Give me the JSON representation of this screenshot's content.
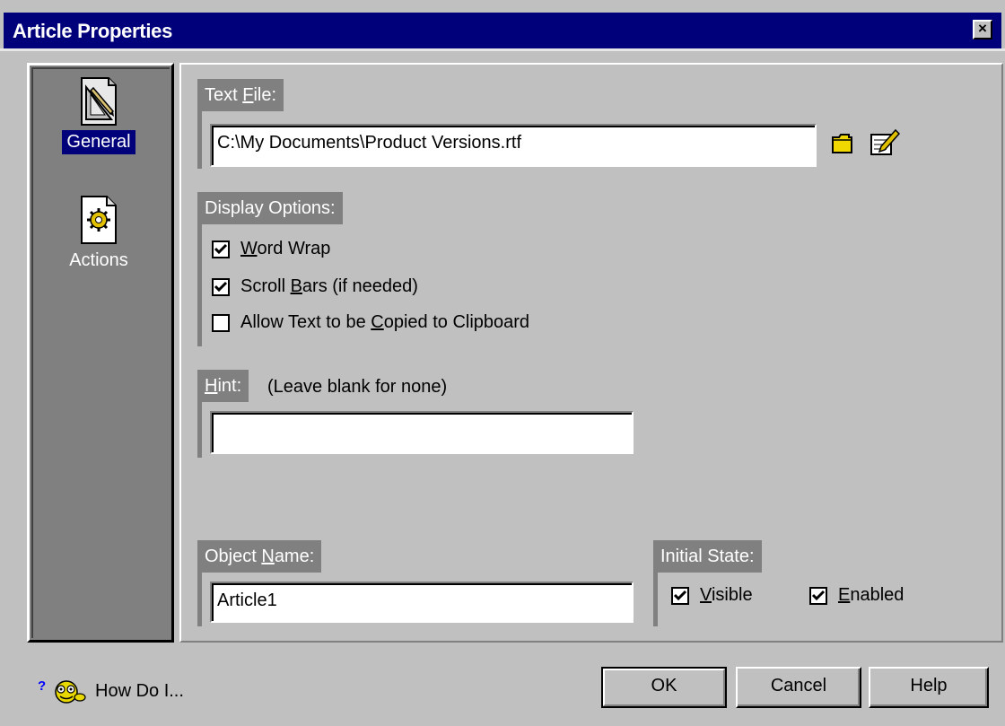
{
  "window": {
    "title": "Article Properties",
    "close_glyph": "×"
  },
  "sidebar": {
    "items": [
      {
        "label": "General",
        "icon": "pencil-ruler-icon",
        "selected": true
      },
      {
        "label": "Actions",
        "icon": "gear-page-icon",
        "selected": false
      }
    ]
  },
  "text_file": {
    "label_pre": "Text ",
    "label_mnemonic": "F",
    "label_post": "ile:",
    "value": "C:\\My Documents\\Product Versions.rtf",
    "browse_icon": "folder-icon",
    "edit_icon": "edit-document-icon"
  },
  "display_options": {
    "label": "Display Options:",
    "options": [
      {
        "pre": "",
        "mnemonic": "W",
        "post": "ord Wrap",
        "checked": true
      },
      {
        "pre": "Scroll ",
        "mnemonic": "B",
        "post": "ars (if needed)",
        "checked": true
      },
      {
        "pre": "Allow Text to be ",
        "mnemonic": "C",
        "post": "opied to Clipboard",
        "checked": false
      }
    ]
  },
  "hint": {
    "label_mnemonic": "H",
    "label_post": "int:",
    "note": "(Leave blank for none)",
    "value": ""
  },
  "object_name": {
    "label_pre": "Object ",
    "label_mnemonic": "N",
    "label_post": "ame:",
    "value": "Article1"
  },
  "initial_state": {
    "label": "Initial State:",
    "visible": {
      "mnemonic": "V",
      "post": "isible",
      "checked": true
    },
    "enabled": {
      "mnemonic": "E",
      "post": "nabled",
      "checked": true
    }
  },
  "footer": {
    "how_do_i": "How Do I...",
    "ok": "OK",
    "cancel": "Cancel",
    "help": "Help"
  },
  "colors": {
    "titlebar": "#00007b",
    "face": "#c0c0c0",
    "shadow": "#808080",
    "selection": "#00007b"
  }
}
